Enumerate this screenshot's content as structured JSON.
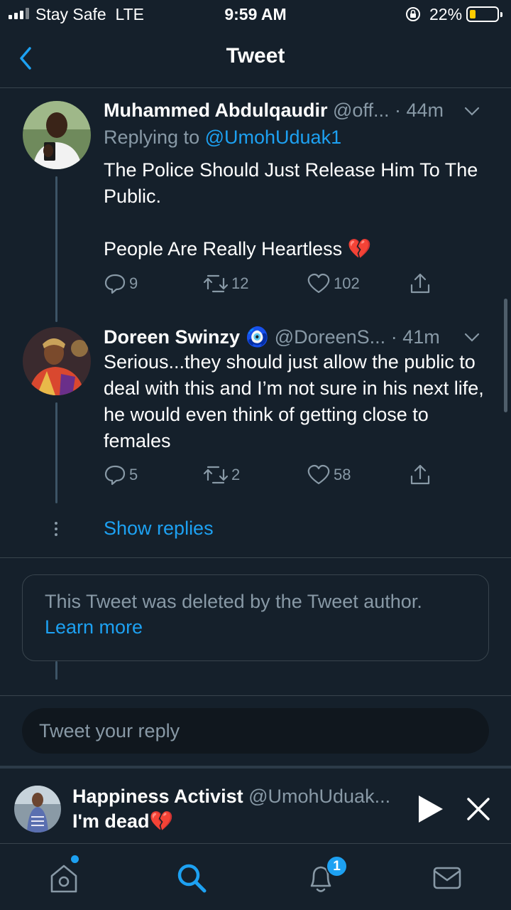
{
  "status_bar": {
    "carrier": "Stay Safe  LTE",
    "time": "9:59 AM",
    "battery": "22%",
    "battery_level": 0.22
  },
  "header": {
    "title": "Tweet"
  },
  "tweets": [
    {
      "name": "Muhammed Abdulqaudir",
      "handle": "@off...",
      "time": "· 44m",
      "reply_prefix": "Replying to ",
      "reply_mention": "@UmohUduak1",
      "text": "The Police Should Just Release Him To The Public.\n\nPeople Are Really Heartless 💔",
      "replies": "9",
      "retweets": "12",
      "likes": "102"
    },
    {
      "name": "Doreen Swinzy",
      "name_emoji": "🧿",
      "handle": "@DoreenS...",
      "time": "· 41m",
      "text": "Serious...they should just allow the public to deal with this and I’m not sure in his next life, he would even think of getting close to females",
      "replies": "5",
      "retweets": "2",
      "likes": "58"
    }
  ],
  "show_replies": "Show replies",
  "deleted": {
    "text": "This Tweet was deleted by the Tweet author.",
    "link": "Learn more"
  },
  "reply_input": {
    "placeholder": "Tweet your reply"
  },
  "mini_player": {
    "name": "Happiness Activist",
    "handle": "@UmohUduak...",
    "text": "I'm dead💔"
  },
  "tabbar": {
    "notifications_badge": "1"
  },
  "icons": [
    "back-arrow-icon",
    "reply-icon",
    "retweet-icon",
    "like-icon",
    "share-icon",
    "play-icon",
    "close-icon",
    "home-icon",
    "search-icon",
    "notifications-icon",
    "messages-icon"
  ],
  "colors": {
    "background": "#15202b",
    "accent": "#1da1f2",
    "muted": "#8899a6",
    "border": "#38444d"
  }
}
